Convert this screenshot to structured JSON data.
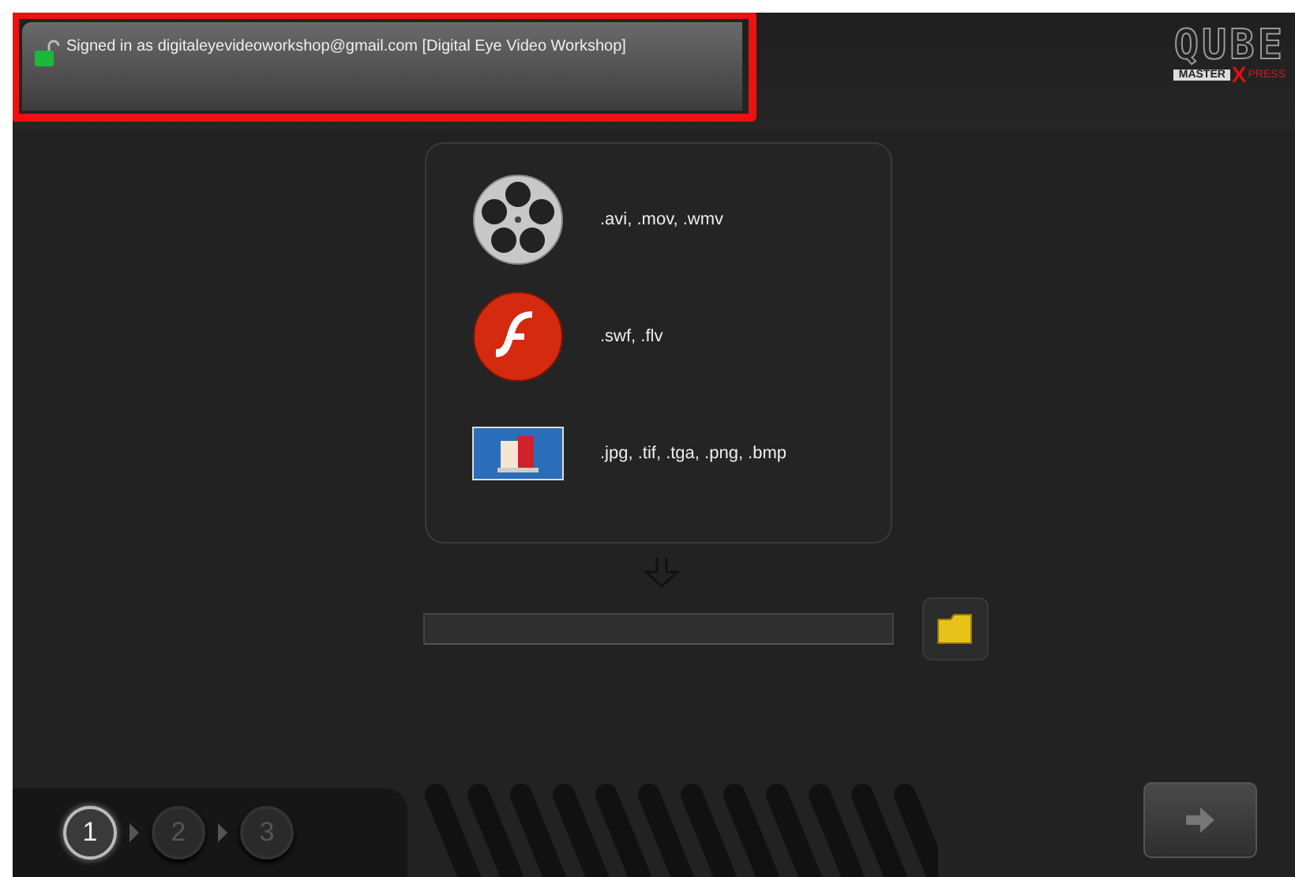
{
  "header": {
    "signed_in": "Signed in as digitaleyevideoworkshop@gmail.com [Digital Eye Video Workshop]",
    "highlighted": true
  },
  "logo": {
    "main": "QUBE",
    "sub": "MASTER",
    "accent": "X",
    "rest": "PRESS"
  },
  "formats": [
    {
      "kind": "reel",
      "extensions": ".avi, .mov, .wmv"
    },
    {
      "kind": "flash",
      "extensions": ".swf, .flv"
    },
    {
      "kind": "image",
      "extensions": ".jpg, .tif, .tga, .png, .bmp"
    }
  ],
  "steps": [
    {
      "label": "1",
      "selected": true
    },
    {
      "label": "2",
      "selected": false
    },
    {
      "label": "3",
      "selected": false
    }
  ]
}
